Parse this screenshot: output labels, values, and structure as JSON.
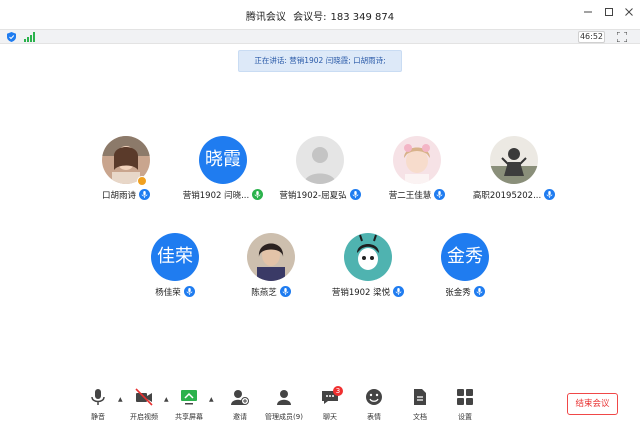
{
  "window": {
    "app_title": "腾讯会议",
    "meeting_id_label": "会议号:",
    "meeting_id": "183 349 874",
    "minimize_icon": "minimize-icon",
    "maximize_icon": "maximize-icon",
    "close_icon": "close-icon"
  },
  "status": {
    "timer": "46:52",
    "security_icon": "shield-icon",
    "network_icon": "signal-icon",
    "fullscreen_icon": "fullscreen-icon"
  },
  "speaking_banner": "正在讲话: 营销1902 闫晓霞; 口胡雨诗;",
  "participants": [
    {
      "name": "口胡雨诗",
      "avatar_type": "photo",
      "avatar_text": "",
      "host": true
    },
    {
      "name": "营销1902 闫晓...",
      "avatar_type": "text",
      "avatar_text": "晓霞",
      "host": false
    },
    {
      "name": "营销1902-屈夏弘",
      "avatar_type": "default",
      "avatar_text": "",
      "host": false
    },
    {
      "name": "营二王佳慧",
      "avatar_type": "photo",
      "avatar_text": "",
      "host": false
    },
    {
      "name": "高职20195202...",
      "avatar_type": "photo",
      "avatar_text": "",
      "host": false
    },
    {
      "name": "杨佳荣",
      "avatar_type": "text",
      "avatar_text": "佳荣",
      "host": false
    },
    {
      "name": "陈燕芝",
      "avatar_type": "photo",
      "avatar_text": "",
      "host": false
    },
    {
      "name": "营销1902 梁悦",
      "avatar_type": "photo",
      "avatar_text": "",
      "host": false
    },
    {
      "name": "张金秀",
      "avatar_type": "text",
      "avatar_text": "金秀",
      "host": false
    }
  ],
  "colors": {
    "accent": "#1f7cf0",
    "end_button": "#e83030",
    "banner_bg": "#dde9f8"
  },
  "toolbar": {
    "mute_label": "静音",
    "video_label": "开启视频",
    "share_label": "共享屏幕",
    "invite_label": "邀请",
    "members_label": "管理成员(9)",
    "chat_label": "聊天",
    "chat_badge": "3",
    "emoji_label": "表情",
    "docs_label": "文档",
    "settings_label": "设置",
    "end_label": "结束会议"
  }
}
